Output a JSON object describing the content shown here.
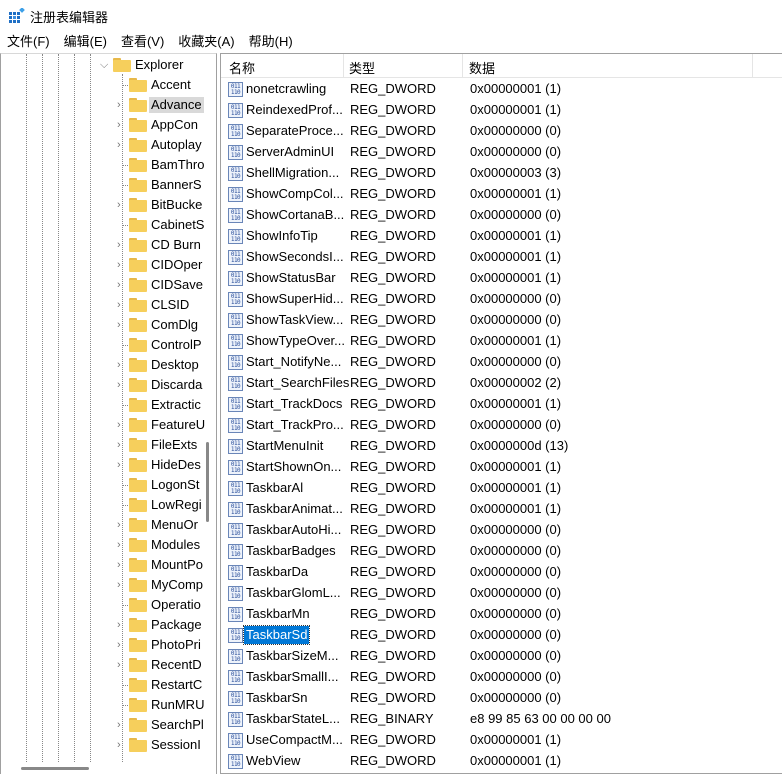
{
  "window": {
    "title": "注册表编辑器"
  },
  "menu": [
    "文件(F)",
    "编辑(E)",
    "查看(V)",
    "收藏夹(A)",
    "帮助(H)"
  ],
  "tree": {
    "parent": "Explorer",
    "selected": "Advanced",
    "children": [
      {
        "label": "Accent",
        "expandable": false
      },
      {
        "label": "Advance",
        "expandable": true
      },
      {
        "label": "AppCon",
        "expandable": true
      },
      {
        "label": "Autoplay",
        "expandable": true
      },
      {
        "label": "BamThro",
        "expandable": false
      },
      {
        "label": "BannerS",
        "expandable": false
      },
      {
        "label": "BitBucke",
        "expandable": true
      },
      {
        "label": "CabinetS",
        "expandable": false
      },
      {
        "label": "CD Burn",
        "expandable": true
      },
      {
        "label": "CIDOper",
        "expandable": true
      },
      {
        "label": "CIDSave",
        "expandable": true
      },
      {
        "label": "CLSID",
        "expandable": true
      },
      {
        "label": "ComDlg",
        "expandable": true
      },
      {
        "label": "ControlP",
        "expandable": false
      },
      {
        "label": "Desktop",
        "expandable": true
      },
      {
        "label": "Discarda",
        "expandable": true
      },
      {
        "label": "Extractic",
        "expandable": false
      },
      {
        "label": "FeatureU",
        "expandable": true
      },
      {
        "label": "FileExts",
        "expandable": true
      },
      {
        "label": "HideDes",
        "expandable": true
      },
      {
        "label": "LogonSt",
        "expandable": false
      },
      {
        "label": "LowRegi",
        "expandable": false
      },
      {
        "label": "MenuOr",
        "expandable": true
      },
      {
        "label": "Modules",
        "expandable": true
      },
      {
        "label": "MountPo",
        "expandable": true
      },
      {
        "label": "MyComp",
        "expandable": true
      },
      {
        "label": "Operatio",
        "expandable": false
      },
      {
        "label": "Package",
        "expandable": true
      },
      {
        "label": "PhotoPri",
        "expandable": true
      },
      {
        "label": "RecentD",
        "expandable": true
      },
      {
        "label": "RestartC",
        "expandable": false
      },
      {
        "label": "RunMRU",
        "expandable": false
      },
      {
        "label": "SearchPl",
        "expandable": true
      },
      {
        "label": "SessionI",
        "expandable": true
      }
    ]
  },
  "list": {
    "headers": {
      "name": "名称",
      "type": "类型",
      "data": "数据"
    },
    "selected": "TaskbarSd",
    "rows": [
      {
        "name": "nonetcrawling",
        "type": "REG_DWORD",
        "data": "0x00000001 (1)"
      },
      {
        "name": "ReindexedProf...",
        "type": "REG_DWORD",
        "data": "0x00000001 (1)"
      },
      {
        "name": "SeparateProce...",
        "type": "REG_DWORD",
        "data": "0x00000000 (0)"
      },
      {
        "name": "ServerAdminUI",
        "type": "REG_DWORD",
        "data": "0x00000000 (0)"
      },
      {
        "name": "ShellMigration...",
        "type": "REG_DWORD",
        "data": "0x00000003 (3)"
      },
      {
        "name": "ShowCompCol...",
        "type": "REG_DWORD",
        "data": "0x00000001 (1)"
      },
      {
        "name": "ShowCortanaB...",
        "type": "REG_DWORD",
        "data": "0x00000000 (0)"
      },
      {
        "name": "ShowInfoTip",
        "type": "REG_DWORD",
        "data": "0x00000001 (1)"
      },
      {
        "name": "ShowSecondsI...",
        "type": "REG_DWORD",
        "data": "0x00000001 (1)"
      },
      {
        "name": "ShowStatusBar",
        "type": "REG_DWORD",
        "data": "0x00000001 (1)"
      },
      {
        "name": "ShowSuperHid...",
        "type": "REG_DWORD",
        "data": "0x00000000 (0)"
      },
      {
        "name": "ShowTaskView...",
        "type": "REG_DWORD",
        "data": "0x00000000 (0)"
      },
      {
        "name": "ShowTypeOver...",
        "type": "REG_DWORD",
        "data": "0x00000001 (1)"
      },
      {
        "name": "Start_NotifyNe...",
        "type": "REG_DWORD",
        "data": "0x00000000 (0)"
      },
      {
        "name": "Start_SearchFiles",
        "type": "REG_DWORD",
        "data": "0x00000002 (2)"
      },
      {
        "name": "Start_TrackDocs",
        "type": "REG_DWORD",
        "data": "0x00000001 (1)"
      },
      {
        "name": "Start_TrackPro...",
        "type": "REG_DWORD",
        "data": "0x00000000 (0)"
      },
      {
        "name": "StartMenuInit",
        "type": "REG_DWORD",
        "data": "0x0000000d (13)"
      },
      {
        "name": "StartShownOn...",
        "type": "REG_DWORD",
        "data": "0x00000001 (1)"
      },
      {
        "name": "TaskbarAl",
        "type": "REG_DWORD",
        "data": "0x00000001 (1)"
      },
      {
        "name": "TaskbarAnimat...",
        "type": "REG_DWORD",
        "data": "0x00000001 (1)"
      },
      {
        "name": "TaskbarAutoHi...",
        "type": "REG_DWORD",
        "data": "0x00000000 (0)"
      },
      {
        "name": "TaskbarBadges",
        "type": "REG_DWORD",
        "data": "0x00000000 (0)"
      },
      {
        "name": "TaskbarDa",
        "type": "REG_DWORD",
        "data": "0x00000000 (0)"
      },
      {
        "name": "TaskbarGlomL...",
        "type": "REG_DWORD",
        "data": "0x00000000 (0)"
      },
      {
        "name": "TaskbarMn",
        "type": "REG_DWORD",
        "data": "0x00000000 (0)"
      },
      {
        "name": "TaskbarSd",
        "type": "REG_DWORD",
        "data": "0x00000000 (0)"
      },
      {
        "name": "TaskbarSizeM...",
        "type": "REG_DWORD",
        "data": "0x00000000 (0)"
      },
      {
        "name": "TaskbarSmallI...",
        "type": "REG_DWORD",
        "data": "0x00000000 (0)"
      },
      {
        "name": "TaskbarSn",
        "type": "REG_DWORD",
        "data": "0x00000000 (0)"
      },
      {
        "name": "TaskbarStateL...",
        "type": "REG_BINARY",
        "data": "e8 99 85 63 00 00 00 00"
      },
      {
        "name": "UseCompactM...",
        "type": "REG_DWORD",
        "data": "0x00000001 (1)"
      },
      {
        "name": "WebView",
        "type": "REG_DWORD",
        "data": "0x00000001 (1)"
      }
    ]
  },
  "colors": {
    "selection": "#0078d7",
    "folder": "#f6cf5c"
  }
}
